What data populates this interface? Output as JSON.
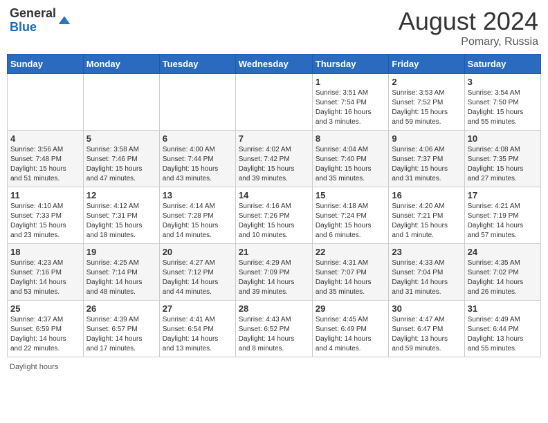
{
  "header": {
    "logo_general": "General",
    "logo_blue": "Blue",
    "month_year": "August 2024",
    "location": "Pomary, Russia"
  },
  "days_of_week": [
    "Sunday",
    "Monday",
    "Tuesday",
    "Wednesday",
    "Thursday",
    "Friday",
    "Saturday"
  ],
  "weeks": [
    [
      {
        "day": "",
        "info": ""
      },
      {
        "day": "",
        "info": ""
      },
      {
        "day": "",
        "info": ""
      },
      {
        "day": "",
        "info": ""
      },
      {
        "day": "1",
        "info": "Sunrise: 3:51 AM\nSunset: 7:54 PM\nDaylight: 16 hours\nand 3 minutes."
      },
      {
        "day": "2",
        "info": "Sunrise: 3:53 AM\nSunset: 7:52 PM\nDaylight: 15 hours\nand 59 minutes."
      },
      {
        "day": "3",
        "info": "Sunrise: 3:54 AM\nSunset: 7:50 PM\nDaylight: 15 hours\nand 55 minutes."
      }
    ],
    [
      {
        "day": "4",
        "info": "Sunrise: 3:56 AM\nSunset: 7:48 PM\nDaylight: 15 hours\nand 51 minutes."
      },
      {
        "day": "5",
        "info": "Sunrise: 3:58 AM\nSunset: 7:46 PM\nDaylight: 15 hours\nand 47 minutes."
      },
      {
        "day": "6",
        "info": "Sunrise: 4:00 AM\nSunset: 7:44 PM\nDaylight: 15 hours\nand 43 minutes."
      },
      {
        "day": "7",
        "info": "Sunrise: 4:02 AM\nSunset: 7:42 PM\nDaylight: 15 hours\nand 39 minutes."
      },
      {
        "day": "8",
        "info": "Sunrise: 4:04 AM\nSunset: 7:40 PM\nDaylight: 15 hours\nand 35 minutes."
      },
      {
        "day": "9",
        "info": "Sunrise: 4:06 AM\nSunset: 7:37 PM\nDaylight: 15 hours\nand 31 minutes."
      },
      {
        "day": "10",
        "info": "Sunrise: 4:08 AM\nSunset: 7:35 PM\nDaylight: 15 hours\nand 27 minutes."
      }
    ],
    [
      {
        "day": "11",
        "info": "Sunrise: 4:10 AM\nSunset: 7:33 PM\nDaylight: 15 hours\nand 23 minutes."
      },
      {
        "day": "12",
        "info": "Sunrise: 4:12 AM\nSunset: 7:31 PM\nDaylight: 15 hours\nand 18 minutes."
      },
      {
        "day": "13",
        "info": "Sunrise: 4:14 AM\nSunset: 7:28 PM\nDaylight: 15 hours\nand 14 minutes."
      },
      {
        "day": "14",
        "info": "Sunrise: 4:16 AM\nSunset: 7:26 PM\nDaylight: 15 hours\nand 10 minutes."
      },
      {
        "day": "15",
        "info": "Sunrise: 4:18 AM\nSunset: 7:24 PM\nDaylight: 15 hours\nand 6 minutes."
      },
      {
        "day": "16",
        "info": "Sunrise: 4:20 AM\nSunset: 7:21 PM\nDaylight: 15 hours\nand 1 minute."
      },
      {
        "day": "17",
        "info": "Sunrise: 4:21 AM\nSunset: 7:19 PM\nDaylight: 14 hours\nand 57 minutes."
      }
    ],
    [
      {
        "day": "18",
        "info": "Sunrise: 4:23 AM\nSunset: 7:16 PM\nDaylight: 14 hours\nand 53 minutes."
      },
      {
        "day": "19",
        "info": "Sunrise: 4:25 AM\nSunset: 7:14 PM\nDaylight: 14 hours\nand 48 minutes."
      },
      {
        "day": "20",
        "info": "Sunrise: 4:27 AM\nSunset: 7:12 PM\nDaylight: 14 hours\nand 44 minutes."
      },
      {
        "day": "21",
        "info": "Sunrise: 4:29 AM\nSunset: 7:09 PM\nDaylight: 14 hours\nand 39 minutes."
      },
      {
        "day": "22",
        "info": "Sunrise: 4:31 AM\nSunset: 7:07 PM\nDaylight: 14 hours\nand 35 minutes."
      },
      {
        "day": "23",
        "info": "Sunrise: 4:33 AM\nSunset: 7:04 PM\nDaylight: 14 hours\nand 31 minutes."
      },
      {
        "day": "24",
        "info": "Sunrise: 4:35 AM\nSunset: 7:02 PM\nDaylight: 14 hours\nand 26 minutes."
      }
    ],
    [
      {
        "day": "25",
        "info": "Sunrise: 4:37 AM\nSunset: 6:59 PM\nDaylight: 14 hours\nand 22 minutes."
      },
      {
        "day": "26",
        "info": "Sunrise: 4:39 AM\nSunset: 6:57 PM\nDaylight: 14 hours\nand 17 minutes."
      },
      {
        "day": "27",
        "info": "Sunrise: 4:41 AM\nSunset: 6:54 PM\nDaylight: 14 hours\nand 13 minutes."
      },
      {
        "day": "28",
        "info": "Sunrise: 4:43 AM\nSunset: 6:52 PM\nDaylight: 14 hours\nand 8 minutes."
      },
      {
        "day": "29",
        "info": "Sunrise: 4:45 AM\nSunset: 6:49 PM\nDaylight: 14 hours\nand 4 minutes."
      },
      {
        "day": "30",
        "info": "Sunrise: 4:47 AM\nSunset: 6:47 PM\nDaylight: 13 hours\nand 59 minutes."
      },
      {
        "day": "31",
        "info": "Sunrise: 4:49 AM\nSunset: 6:44 PM\nDaylight: 13 hours\nand 55 minutes."
      }
    ]
  ],
  "footer": {
    "daylight_label": "Daylight hours"
  }
}
